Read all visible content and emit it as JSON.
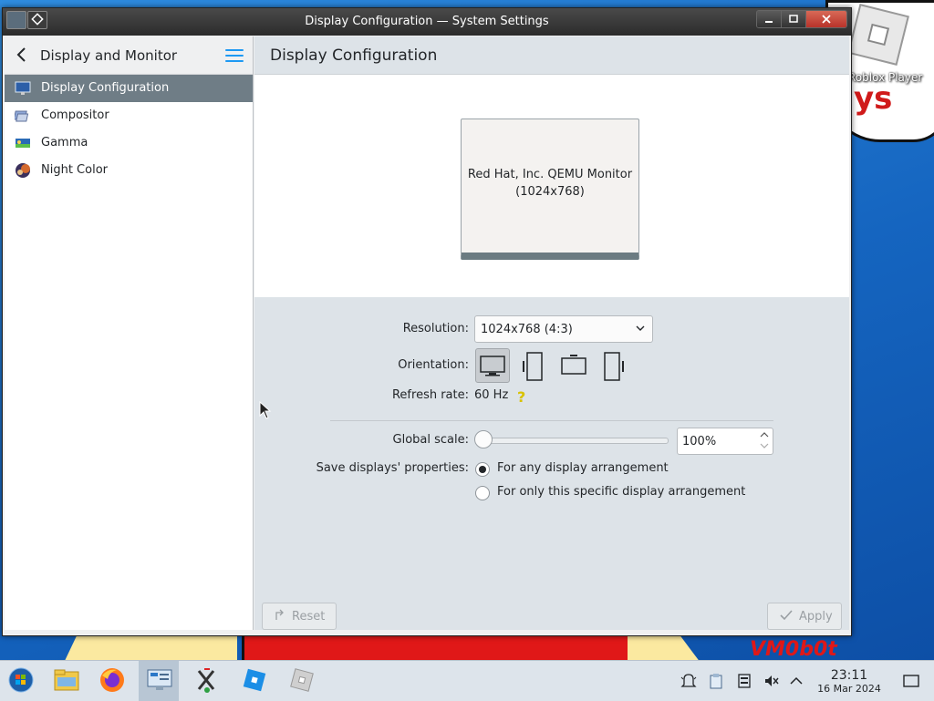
{
  "window": {
    "title": "Display Configuration — System Settings"
  },
  "desktop": {
    "icon_label": "Roblox Player",
    "bg_text_top": "ys",
    "bg_text_bottom": "VM0b0t"
  },
  "sidebar": {
    "header_title": "Display and Monitor",
    "items": [
      {
        "label": "Display Configuration",
        "icon": "display-icon",
        "active": true
      },
      {
        "label": "Compositor",
        "icon": "compositor-icon",
        "active": false
      },
      {
        "label": "Gamma",
        "icon": "gamma-icon",
        "active": false
      },
      {
        "label": "Night Color",
        "icon": "night-color-icon",
        "active": false
      }
    ]
  },
  "main": {
    "page_title": "Display Configuration",
    "monitor": {
      "name": "Red Hat, Inc. QEMU Monitor",
      "resolution": "(1024x768)"
    },
    "resolution": {
      "label": "Resolution:",
      "value": "1024x768 (4:3)"
    },
    "orientation": {
      "label": "Orientation:",
      "options": [
        "landscape-icon",
        "portrait-left-icon",
        "landscape-flipped-icon",
        "portrait-right-icon"
      ],
      "selected": 0
    },
    "refresh_rate": {
      "label": "Refresh rate:",
      "value": "60 Hz"
    },
    "global_scale": {
      "label": "Global scale:",
      "value": "100%",
      "slider_fraction": 0.0
    },
    "save_props": {
      "label": "Save displays' properties:",
      "options": [
        "For any display arrangement",
        "For only this specific display arrangement"
      ],
      "selected": 0
    },
    "buttons": {
      "reset": "Reset",
      "apply": "Apply"
    }
  },
  "taskbar": {
    "apps": [
      "start-orb-icon",
      "file-manager-icon",
      "firefox-icon",
      "system-settings-icon",
      "x-app-icon",
      "roblox-studio-icon",
      "roblox-player-icon"
    ],
    "active_index": 3,
    "clock": {
      "time": "23:11",
      "date": "16 Mar 2024"
    }
  },
  "colors": {
    "accent": "#1d99f3",
    "selection": "#6f7d86",
    "window_bg": "#eff0f1"
  }
}
